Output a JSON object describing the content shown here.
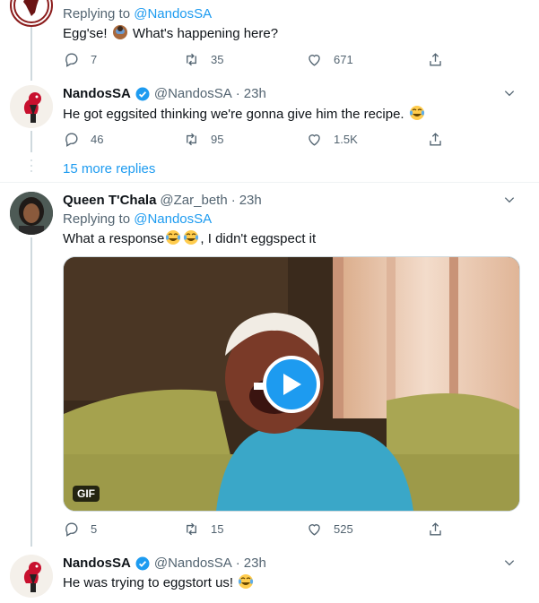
{
  "colors": {
    "accent": "#1d9bf0",
    "text": "#0f1419",
    "muted": "#536471",
    "line": "#cfd9de"
  },
  "tweets": [
    {
      "reply_prefix": "Replying to",
      "mention": "@NandosSA",
      "text_a": "Egg'se!",
      "emoji_a": "face-palm-emoji",
      "text_b": "What's happening here?",
      "replies": "7",
      "retweets": "35",
      "likes": "671"
    },
    {
      "name": "NandosSA",
      "handle": "@NandosSA",
      "sep": "·",
      "time": "23h",
      "text_a": "He got eggsited thinking we're gonna give him the recipe.",
      "emoji_a": "tears-of-joy-emoji",
      "replies": "46",
      "retweets": "95",
      "likes": "1.5K",
      "more_replies": "15 more replies"
    },
    {
      "name": "Queen T'Chala",
      "handle": "@Zar_beth",
      "sep": "·",
      "time": "23h",
      "reply_prefix": "Replying to",
      "mention": "@NandosSA",
      "text_a": "What a response",
      "emoji_a": "tears-of-joy-emoji",
      "text_b": ", I didn't eggspect it",
      "gif_label": "GIF",
      "replies": "5",
      "retweets": "15",
      "likes": "525"
    },
    {
      "name": "NandosSA",
      "handle": "@NandosSA",
      "sep": "·",
      "time": "23h",
      "text_a": "He was trying to eggstort us!",
      "emoji_a": "tears-of-joy-emoji"
    }
  ]
}
